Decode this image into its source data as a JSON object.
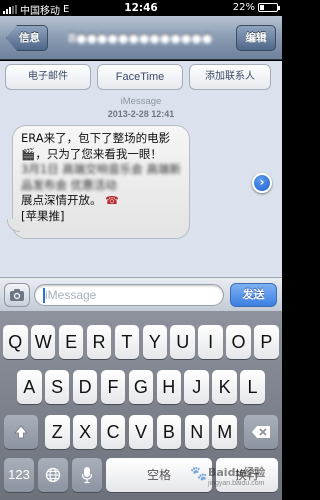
{
  "status_bar": {
    "carrier": "中国移动",
    "network": "E",
    "time": "12:46",
    "battery_text": "22%",
    "battery_level": 0.22
  },
  "nav": {
    "back_label": "信息",
    "title_obscured": "8●●●●●●●●●●●●●",
    "edit_label": "编辑"
  },
  "actions": {
    "email_label": "电子邮件",
    "facetime_label": "FaceTime",
    "add_contact_label": "添加联系人"
  },
  "conversation": {
    "service_label": "iMessage",
    "timestamp": "2013-2-28 12:41",
    "message": {
      "line1": "ERA来了，包下了整场的电影🎬，只为了您来看我一眼！",
      "obscured": "3月1日 高端交响音乐会 高端新品发布会 优惠活动",
      "line2": "展点深情开放。",
      "tail": "[苹果推]"
    }
  },
  "composer": {
    "placeholder": "iMessage",
    "send_label": "发送"
  },
  "keyboard": {
    "row1": [
      "Q",
      "W",
      "E",
      "R",
      "T",
      "Y",
      "U",
      "I",
      "O",
      "P"
    ],
    "row2": [
      "A",
      "S",
      "D",
      "F",
      "G",
      "H",
      "J",
      "K",
      "L"
    ],
    "row3": [
      "Z",
      "X",
      "C",
      "V",
      "B",
      "N",
      "M"
    ],
    "numbers_label": "123",
    "space_label": "空格",
    "return_label": "换行"
  },
  "watermark": {
    "text": "Baidu经验",
    "url": "jingyan.baidu.com"
  }
}
